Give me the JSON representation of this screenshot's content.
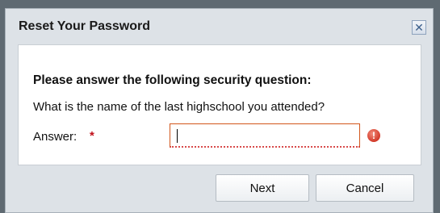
{
  "dialog": {
    "title": "Reset Your Password",
    "close_icon": "close-icon"
  },
  "form": {
    "heading": "Please answer the following security question:",
    "question": "What is the name of the last highschool you attended?",
    "answer_label": "Answer:",
    "required_marker": "*",
    "answer_value": "",
    "error_icon": "error-icon",
    "error_icon_glyph": "!"
  },
  "buttons": {
    "next_label": "Next",
    "cancel_label": "Cancel"
  },
  "colors": {
    "required": "#c0101a",
    "invalid_border": "#d2561b"
  }
}
